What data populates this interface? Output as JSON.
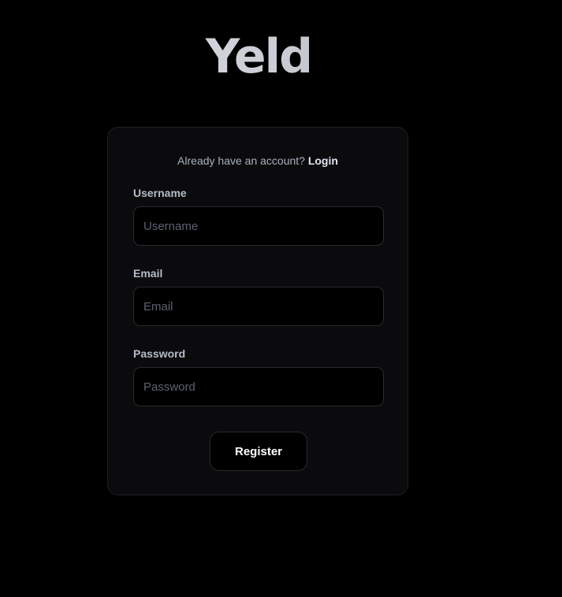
{
  "app": {
    "logo_text": "Yeld"
  },
  "login_prompt": {
    "text": "Already have an account?",
    "link_label": "Login"
  },
  "form": {
    "username": {
      "label": "Username",
      "value": "",
      "placeholder": "Username"
    },
    "email": {
      "label": "Email",
      "value": "",
      "placeholder": "Email"
    },
    "password": {
      "label": "Password",
      "value": "",
      "placeholder": "Password"
    },
    "submit_label": "Register"
  },
  "colors": {
    "page_background": "#000000",
    "card_background": "#0b0b0d",
    "border": "#2a2a30",
    "muted_text": "#a8b0bd",
    "placeholder_text": "#5b6270",
    "button_text": "#ffffff"
  }
}
